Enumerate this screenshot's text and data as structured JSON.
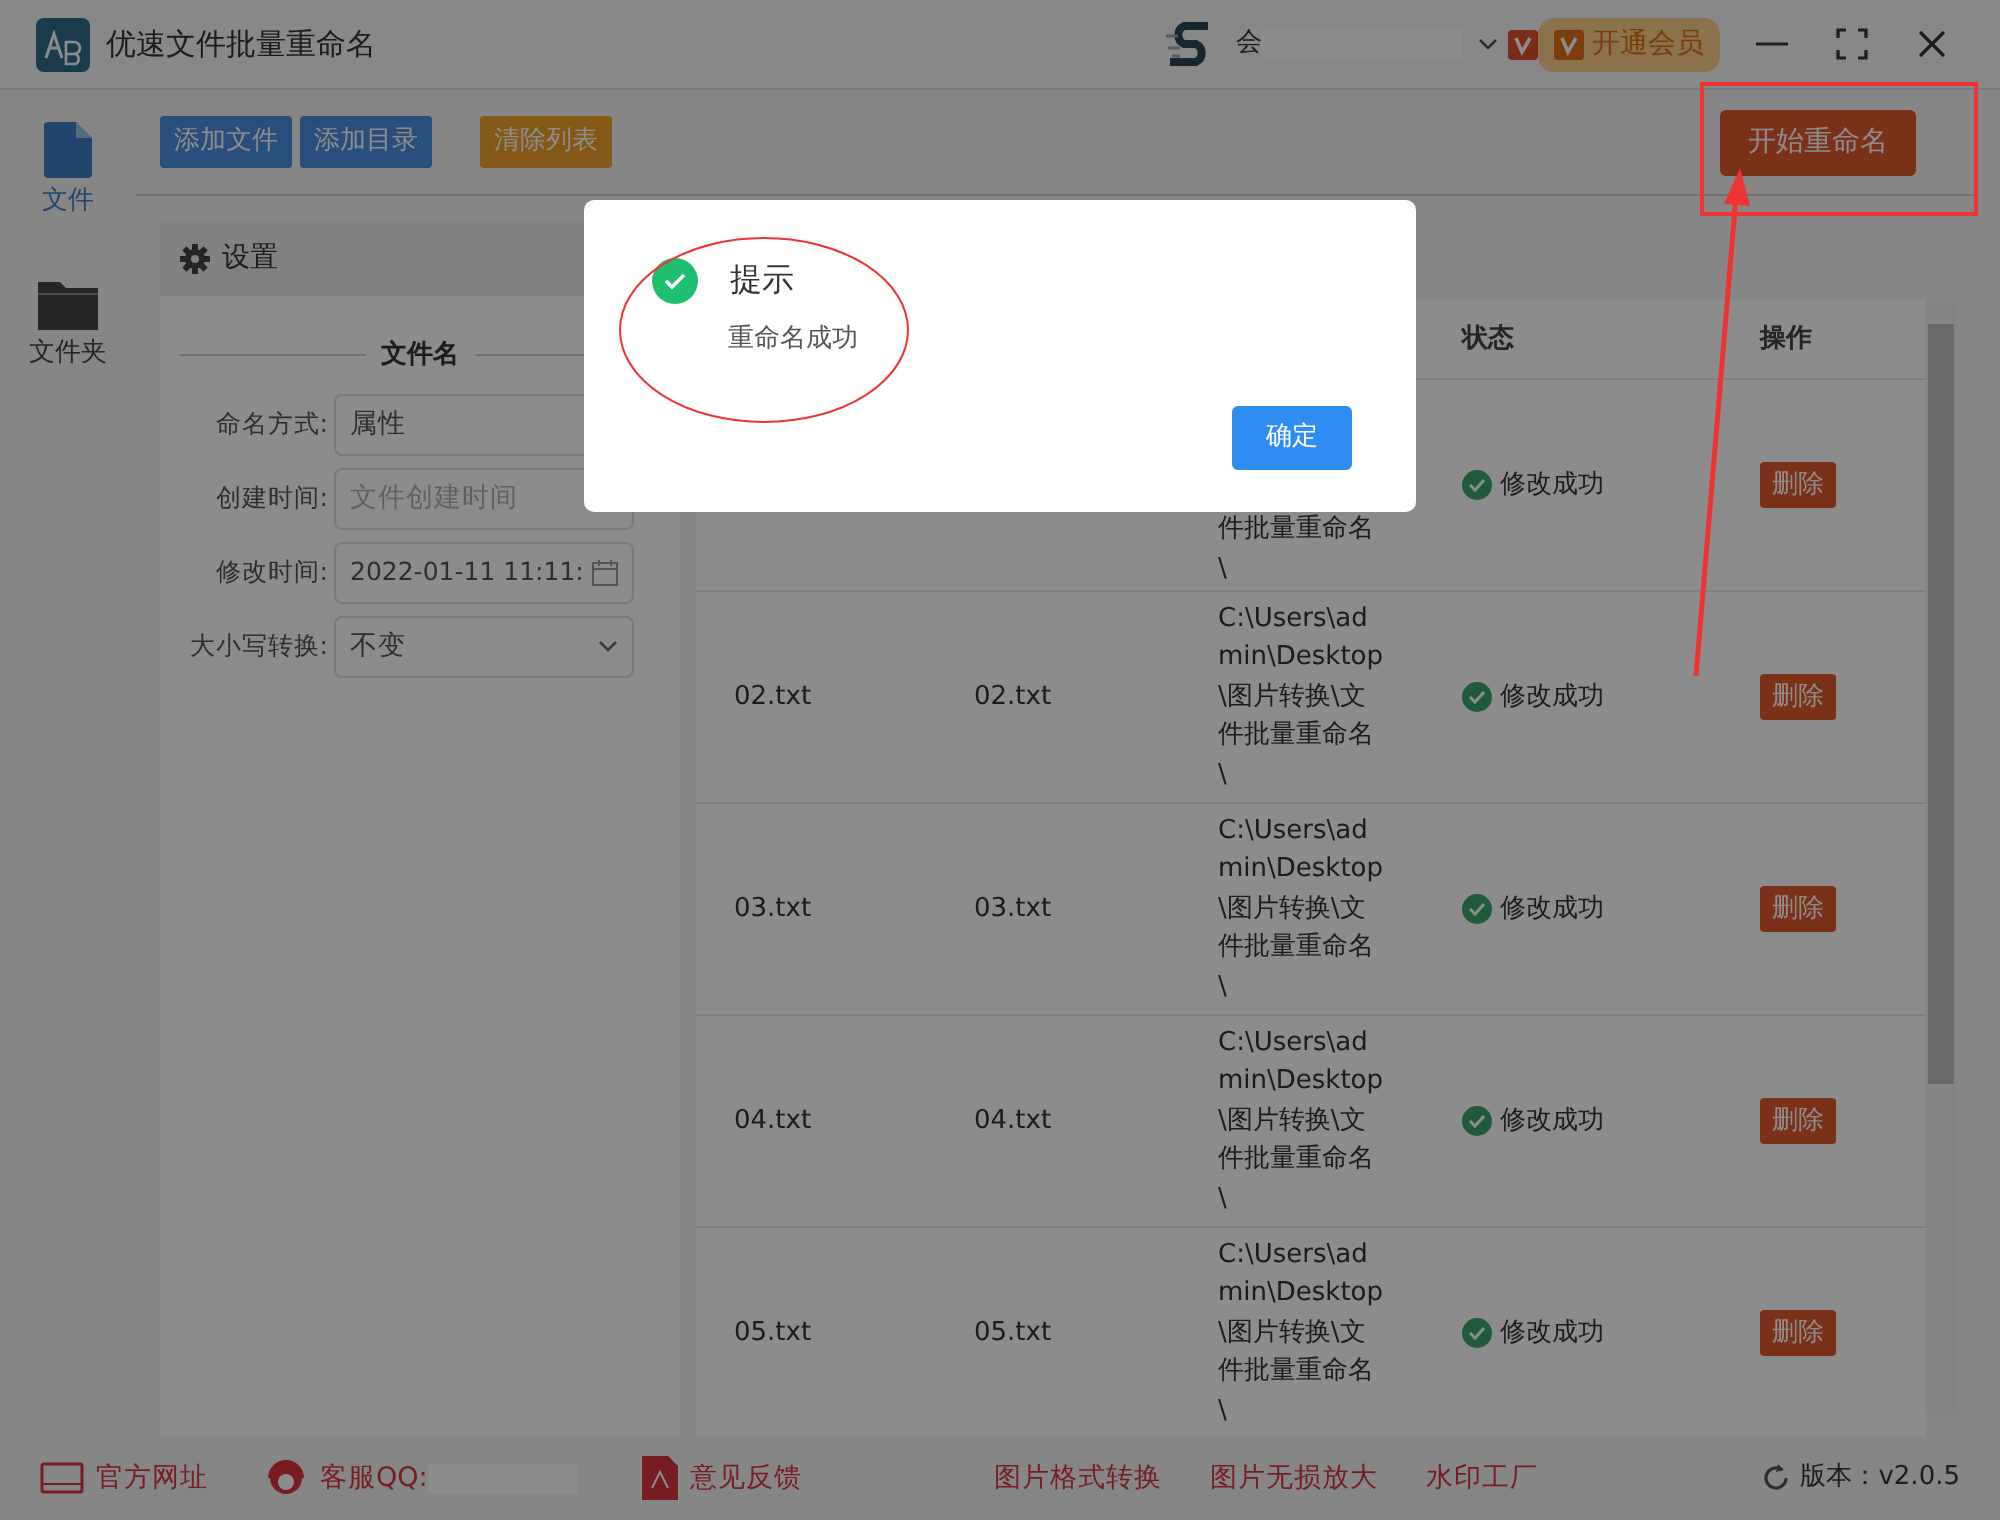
{
  "window": {
    "title": "优速文件批量重命名",
    "user_prefix": "会",
    "vip_button": "开通会员"
  },
  "toolbar": {
    "buttons": [
      {
        "label": "添加文件",
        "kind": "primary"
      },
      {
        "label": "添加目录",
        "kind": "primary"
      },
      {
        "label": "清除列表",
        "kind": "warning"
      }
    ],
    "start_button": "开始重命名"
  },
  "sidebar": {
    "items": [
      {
        "label": "文件",
        "kind": "file",
        "selected": true
      },
      {
        "label": "文件夹",
        "kind": "folder",
        "selected": false
      }
    ]
  },
  "settings": {
    "title": "设置",
    "section": "文件名",
    "fields": [
      {
        "label": "命名方式:",
        "kind": "covered_select",
        "value": "属性"
      },
      {
        "label": "创建时间:",
        "kind": "text",
        "placeholder": "文件创建时间"
      },
      {
        "label": "修改时间:",
        "kind": "date",
        "value": "2022-01-11 11:11:"
      },
      {
        "label": "大小写转换:",
        "kind": "select",
        "value": "不变"
      }
    ]
  },
  "table": {
    "status_header": "状态",
    "action_header": "操作",
    "rows": [
      {
        "path_lines": [
          "件批量重命名",
          "\\"
        ],
        "status": "修改成功",
        "action": "删除"
      },
      {
        "name": "02.txt",
        "new_name": "02.txt",
        "path_lines": [
          "C:\\Users\\ad",
          "min\\Desktop",
          "\\图片转换\\文",
          "件批量重命名",
          "\\"
        ],
        "status": "修改成功",
        "action": "删除"
      },
      {
        "name": "03.txt",
        "new_name": "03.txt",
        "path_lines": [
          "C:\\Users\\ad",
          "min\\Desktop",
          "\\图片转换\\文",
          "件批量重命名",
          "\\"
        ],
        "status": "修改成功",
        "action": "删除"
      },
      {
        "name": "04.txt",
        "new_name": "04.txt",
        "path_lines": [
          "C:\\Users\\ad",
          "min\\Desktop",
          "\\图片转换\\文",
          "件批量重命名",
          "\\"
        ],
        "status": "修改成功",
        "action": "删除"
      },
      {
        "name": "05.txt",
        "new_name": "05.txt",
        "path_lines": [
          "C:\\Users\\ad",
          "min\\Desktop",
          "\\图片转换\\文",
          "件批量重命名",
          "\\"
        ],
        "status": "修改成功",
        "action": "删除"
      }
    ]
  },
  "dialog": {
    "title": "提示",
    "message": "重命名成功",
    "ok_button": "确定"
  },
  "footer": {
    "links": [
      {
        "label": "官方网址",
        "kind": "web"
      },
      {
        "label": "客服QQ:",
        "kind": "qq"
      },
      {
        "label": "意见反馈",
        "kind": "feedback"
      },
      {
        "label": "图片格式转换",
        "kind": "plain"
      },
      {
        "label": "图片无损放大",
        "kind": "plain"
      },
      {
        "label": "水印工厂",
        "kind": "plain"
      }
    ],
    "version": "版本：v2.0.5"
  }
}
